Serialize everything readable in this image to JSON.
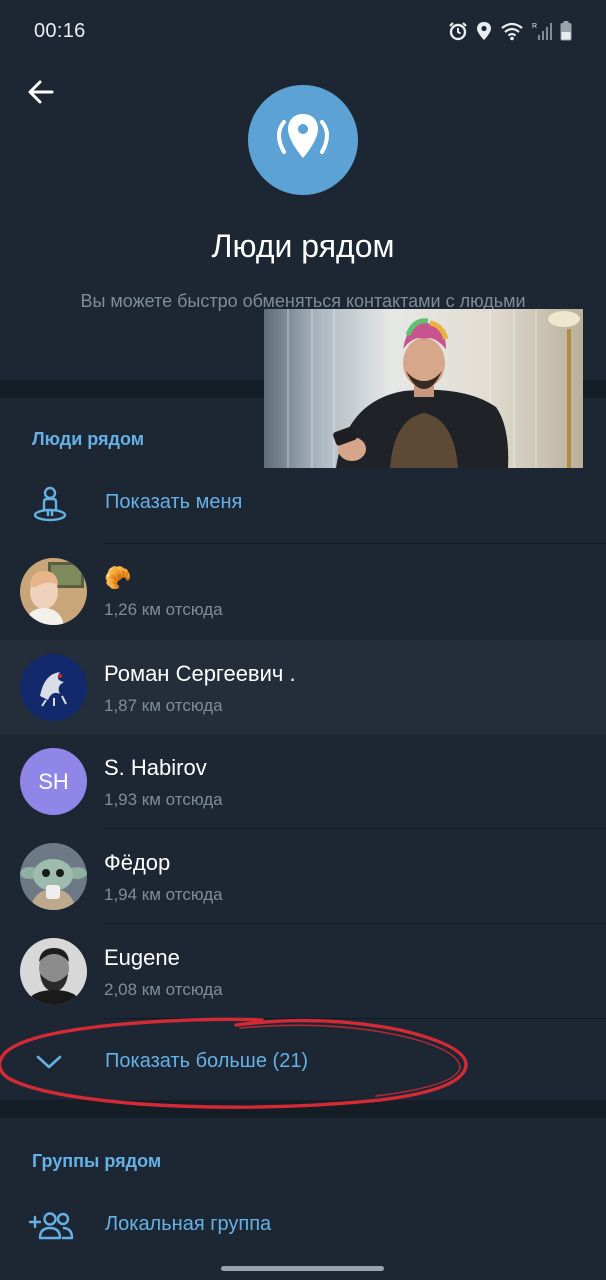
{
  "status_bar": {
    "time": "00:16"
  },
  "header": {
    "title": "Люди рядом",
    "description": "Вы можете быстро обменяться контактами с людьми рядом"
  },
  "people_section": {
    "header": "Люди рядом",
    "show_me_label": "Показать меня",
    "people": [
      {
        "name": "🥐",
        "distance": "1,26 км отсюда",
        "avatar": "photo"
      },
      {
        "name": "Роман Сергеевич .",
        "distance": "1,87 км отсюда",
        "avatar": "crest"
      },
      {
        "name": "S. Habirov",
        "distance": "1,93 км отсюда",
        "avatar_initials": "SH"
      },
      {
        "name": "Фёдор",
        "distance": "1,94 км отсюда",
        "avatar": "photo"
      },
      {
        "name": "Eugene",
        "distance": "2,08 км отсюда",
        "avatar": "photo"
      }
    ],
    "show_more_label": "Показать больше (21)"
  },
  "groups_section": {
    "header": "Группы рядом",
    "local_group_label": "Локальная группа"
  },
  "colors": {
    "background": "#1d2733",
    "accent": "#65b1e6",
    "hero_circle": "#5ca2d5",
    "secondary_text": "#7e8c99",
    "annotation_ellipse": "#d42a35",
    "sh_avatar": "#8f86e8"
  }
}
